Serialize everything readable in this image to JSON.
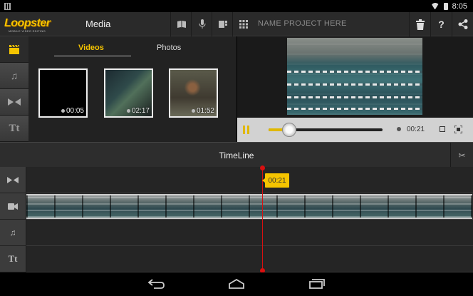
{
  "status_bar": {
    "time": "8:05"
  },
  "toolbar": {
    "logo_text": "Loopster",
    "logo_subtitle": "MOBILE VIDEO EDITING",
    "section_title": "Media",
    "project_name_placeholder": "NAME PROJECT HERE",
    "icons": [
      "book-icon",
      "microphone-icon",
      "storyboard-icon",
      "grid-icon",
      "trash-icon",
      "help-icon",
      "share-icon"
    ]
  },
  "left_tools": [
    {
      "name": "video-clip-tool",
      "icon": "clapper-icon",
      "active": true
    },
    {
      "name": "music-tool",
      "icon": "music-note-icon",
      "active": false
    },
    {
      "name": "transition-tool",
      "icon": "transition-icon",
      "active": false
    },
    {
      "name": "text-tool",
      "icon": "text-icon",
      "label": "Tt",
      "active": false
    }
  ],
  "media": {
    "tabs": {
      "videos": "Videos",
      "photos": "Photos"
    },
    "active_tab": "Videos",
    "thumbnails": [
      {
        "duration": "00:05"
      },
      {
        "duration": "02:17"
      },
      {
        "duration": "01:52"
      }
    ]
  },
  "preview": {
    "current_time": "00:21",
    "progress": 0.18,
    "accent_color": "#f5c400"
  },
  "timeline": {
    "title": "TimeLine",
    "playhead_time": "00:21",
    "tracks": [
      {
        "name": "transition-track",
        "icon": "transition-icon"
      },
      {
        "name": "video-track",
        "icon": "camera-icon"
      },
      {
        "name": "music-track",
        "icon": "music-note-icon"
      },
      {
        "name": "text-track",
        "icon": "text-icon",
        "label": "Tt"
      }
    ]
  },
  "navbar": {
    "buttons": [
      "back-icon",
      "home-icon",
      "recents-icon"
    ]
  }
}
